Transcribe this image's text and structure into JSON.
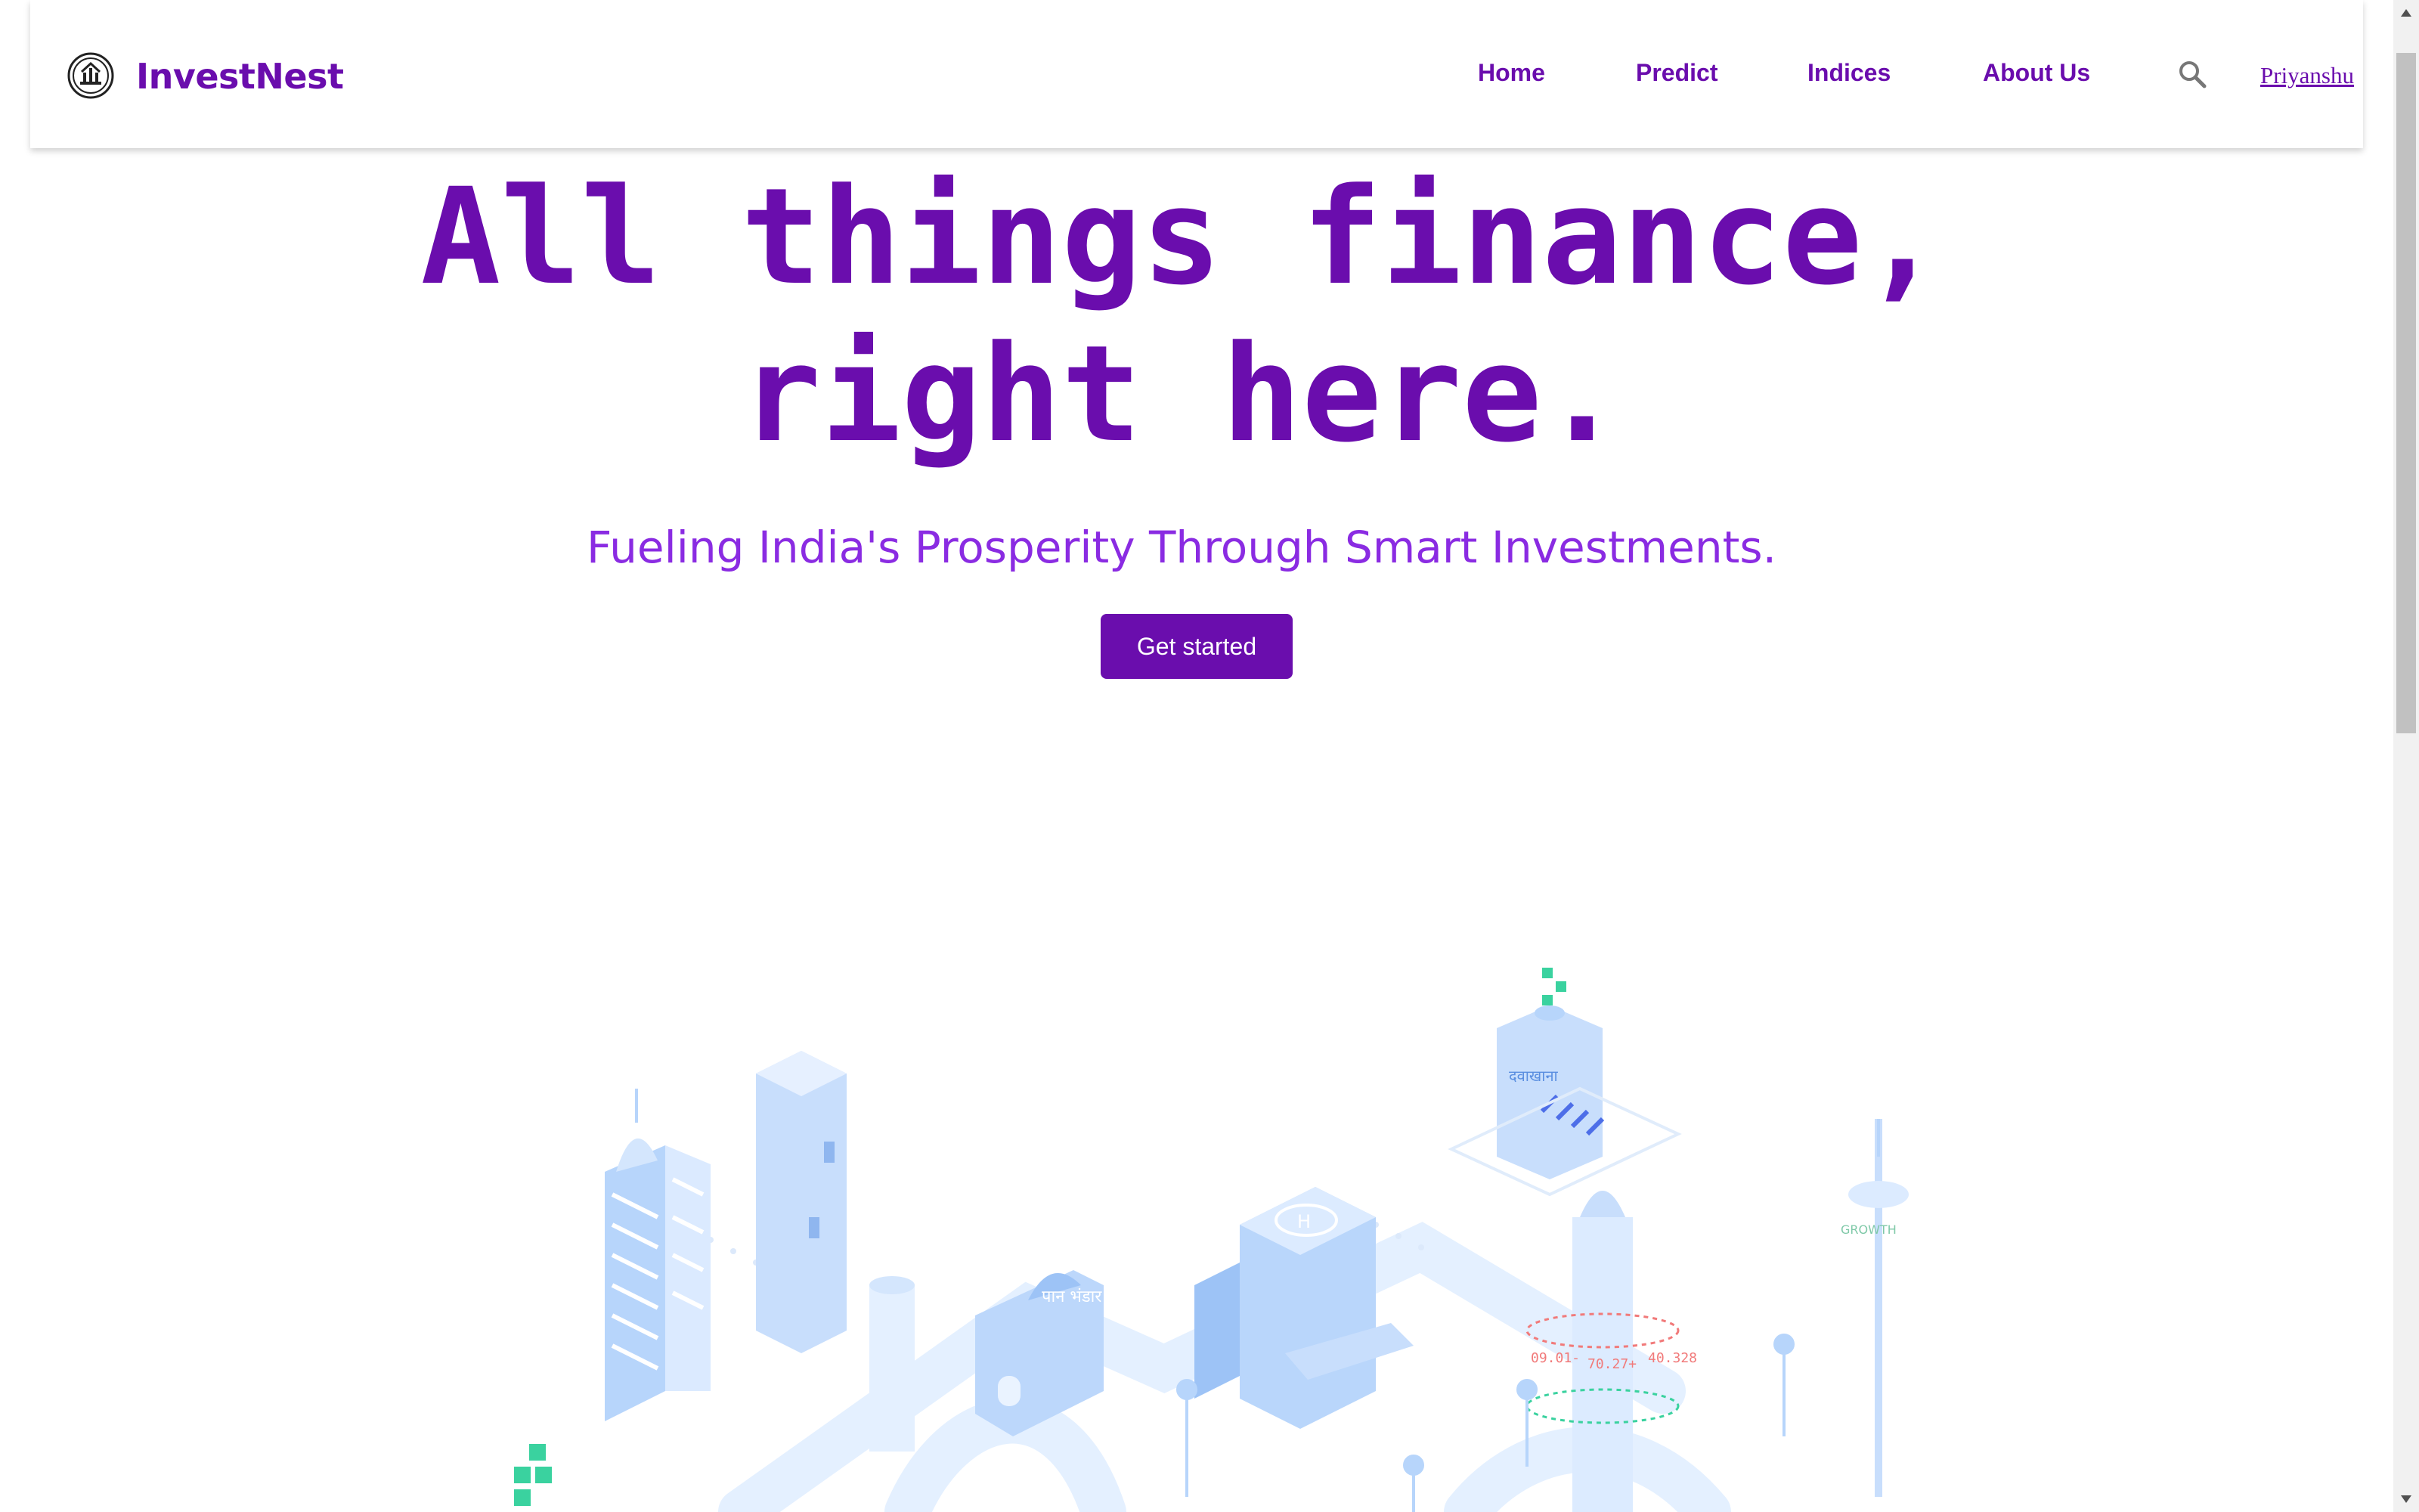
{
  "colors": {
    "brand": "#6a0dad",
    "subtitle": "#8a2be2",
    "illustration": "#cfe4ff",
    "accent_green": "#3ad29f"
  },
  "navbar": {
    "brand": "InvestNest",
    "links": [
      "Home",
      "Predict",
      "Indices",
      "About Us"
    ],
    "search_icon": "search-icon",
    "user": "Priyanshu"
  },
  "hero": {
    "title_line1": "All things finance,",
    "title_line2": "right here.",
    "subtitle": "Fueling India's Prosperity Through Smart Investments.",
    "cta": "Get started"
  },
  "illustration": {
    "shop_sign_1": "दवाखाना",
    "shop_sign_2": "पान भंडार",
    "ticker_values": [
      "09.01-",
      "70.27+",
      "40.328"
    ],
    "tower_label": "GROWTH"
  }
}
